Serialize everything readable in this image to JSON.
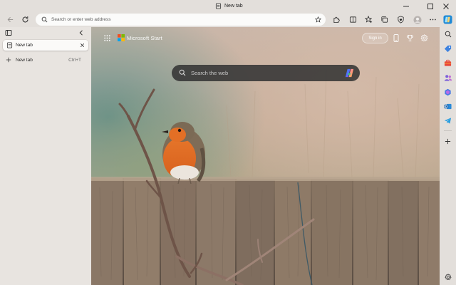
{
  "window": {
    "title": "New tab"
  },
  "toolbar": {
    "address_placeholder": "Search or enter web address"
  },
  "tabs_pane": {
    "active_tab_label": "New tab",
    "new_tab_label": "New tab",
    "new_tab_shortcut": "Ctrl+T"
  },
  "ntp": {
    "brand": "Microsoft Start",
    "signin_label": "Sign in",
    "search_placeholder": "Search the web"
  },
  "colors": {
    "accent": "#0b6cbd",
    "chrome_bg": "#e3dfdb",
    "search_bg": "#343434"
  },
  "icons": [
    "back-arrow-icon",
    "refresh-icon",
    "search-icon",
    "favorite-star-icon",
    "extensions-icon",
    "split-screen-icon",
    "favorites-icon",
    "collections-icon",
    "browser-essentials-icon",
    "profile-icon",
    "more-icon",
    "copilot-icon",
    "sidebar-search-icon",
    "shopping-icon",
    "tools-icon",
    "people-icon",
    "microsoft365-icon",
    "outlook-icon",
    "telegram-icon",
    "add-icon",
    "settings-icon"
  ]
}
